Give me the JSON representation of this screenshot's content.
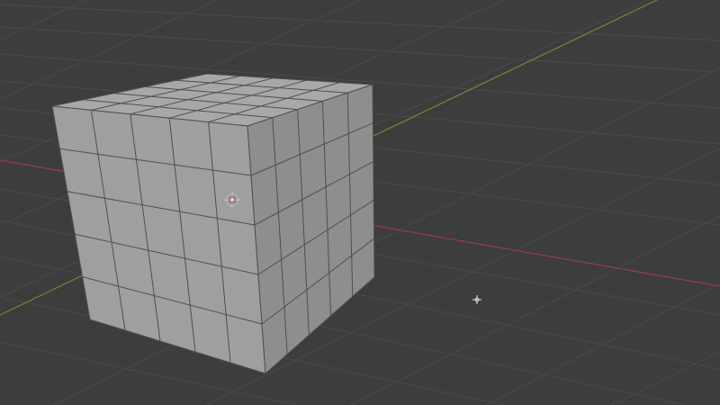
{
  "viewport": {
    "background_color": "#3d3d3d",
    "grid_color": "#4a4a4a",
    "x_axis_color": "#9c3a48",
    "y_axis_color": "#6f8a3a",
    "cube_face_color": "#9f9f9f",
    "cube_edge_color": "#4f4f4f",
    "cube_top_color": "#a8a8a8",
    "cube_right_color": "#8e8e8e",
    "object_origin_icon": "origin-dot-icon",
    "light_icon": "point-light-icon",
    "cursor_icon": "3d-cursor-icon",
    "cube_subdivisions": 5
  }
}
